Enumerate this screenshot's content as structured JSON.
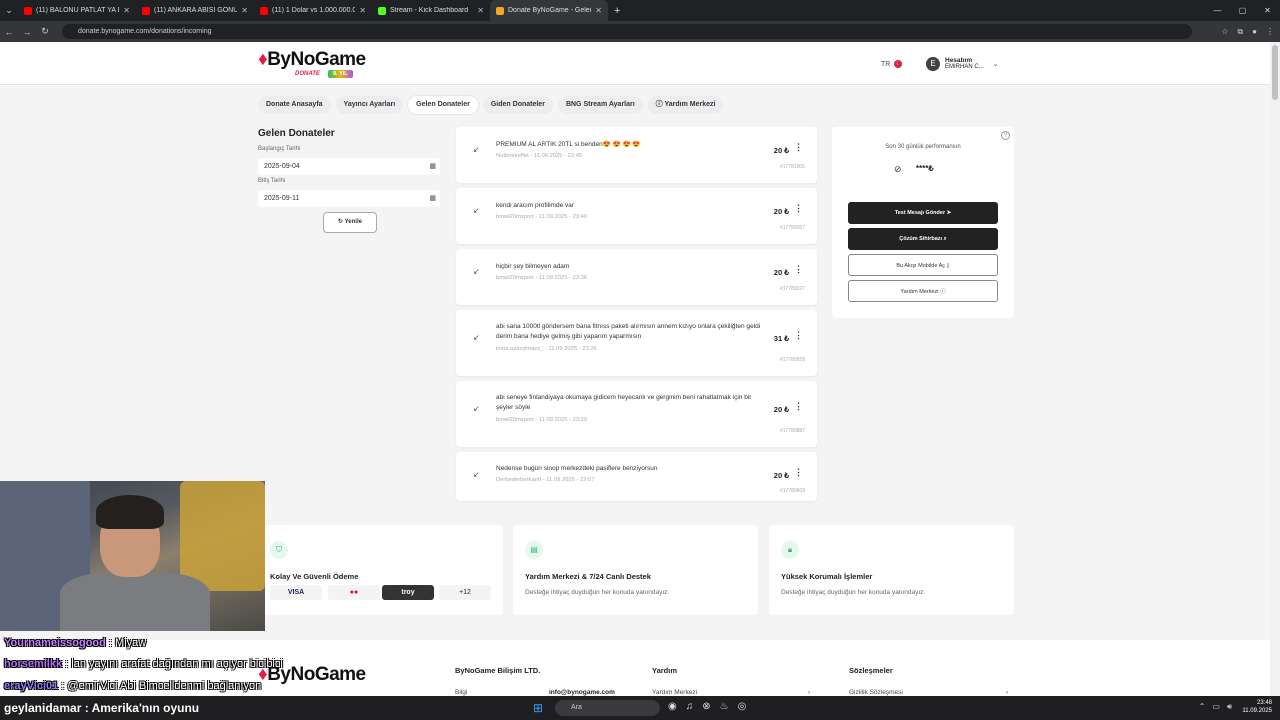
{
  "browser": {
    "tabs": [
      {
        "title": "(11) BALONU PATLAT YA DA GE",
        "color": "#ff0000"
      },
      {
        "title": "(11) ANKARA ABİSİ GÖNÜL Z",
        "color": "#ff0000"
      },
      {
        "title": "(11) 1 Dolar vs 1.000.000.000 D",
        "color": "#ff0000"
      },
      {
        "title": "Stream - Kick Dashboard",
        "color": "#53fc18"
      },
      {
        "title": "Donate ByNoGame - Gelen/Gid",
        "color": "#f5a623"
      }
    ],
    "new_tab": "+",
    "url": "donate.bynogame.com/donations/incoming"
  },
  "header": {
    "logo": "ByNoGame",
    "logo_sub": "DONATE",
    "badge": "9. YIL",
    "lang": "TR",
    "account_title": "Hesabım",
    "account_name": "EMIRHAN C...",
    "avatar_letter": "E"
  },
  "nav": [
    "Donate Anasayfa",
    "Yayıncı Ayarları",
    "Gelen Donateler",
    "Giden Donateler",
    "BNG Stream Ayarları",
    "Yardım Merkezi"
  ],
  "filters": {
    "title": "Gelen Donateler",
    "start_label": "Başlangıç Tarihi",
    "start_value": "2025-09-04",
    "end_label": "Bitiş Tarihi",
    "end_value": "2025-09-11",
    "refresh": "Yenile"
  },
  "donations": [
    {
      "message": "PREMIUM AL ARTIK 20TL si benden😍 😍 😍 😍",
      "meta": "Nutlerekeffet - 11.09.2025 - 23:45",
      "amount": "20 ₺",
      "id": "#17781505"
    },
    {
      "message": "kendi aracım profilimde var",
      "meta": "bmwl20msport - 11.09.2025 - 23:40",
      "amount": "20 ₺",
      "id": "#17783057"
    },
    {
      "message": "hiçbir şey bilmeyen adam",
      "meta": "bmwl20msport - 11.09.2025 - 23:36",
      "amount": "20 ₺",
      "id": "#17783027"
    },
    {
      "message": "abi sana 1000tl göndersem bana fitnıss paketi alırmısın annem kızıyo onlara çekiliğten geldi derim bana hediye gelmiş gibi yaparım yaparmısın",
      "meta": "insta.ayazylmazz_ - 11.09.2025 - 23:26",
      "amount": "31 ₺",
      "id": "#17780928"
    },
    {
      "message": "abi seneye finlandiyaya okumaya gidicem heyecanlı ve gerginim beni rahatlatmak için bir şeyler söyle",
      "meta": "bmwl20msport - 11.09.2025 - 23:19",
      "amount": "20 ₺",
      "id": "#17780887"
    },
    {
      "message": "Nedense bugün sinop merkezdeki pasiflere benziyorsun",
      "meta": "Derbederberkantt - 11.09.2025 - 22:57",
      "amount": "20 ₺",
      "id": "#17780609"
    }
  ],
  "performance": {
    "title": "Son 30 günlük performansın",
    "hidden_value": "****₺",
    "buttons": [
      "Test Mesajı Gönder",
      "Çözüm Sihirbazı",
      "Bu Akışı Mobilde Aç",
      "Yardım Merkezi"
    ]
  },
  "features": [
    {
      "title": "Kolay Ve Güvenli Ödeme",
      "desc": ""
    },
    {
      "title": "Yardım Merkezi & 7/24 Canlı Destek",
      "desc": "Desteğe ihtiyaç duyduğun her konuda yanındayız."
    },
    {
      "title": "Yüksek Korumalı İşlemler",
      "desc": "Desteğe ihtiyaç duyduğun her konuda yanındayız."
    }
  ],
  "payments": [
    "VISA",
    "●●",
    "troy",
    "+12"
  ],
  "footer": {
    "logo": "ByNoGame",
    "company": "ByNoGame Bilişim LTD.",
    "info_label": "Bilgi",
    "email": "info@bynogame.com",
    "help_heading": "Yardım",
    "help_link": "Yardım Merkezi",
    "contracts_heading": "Sözleşmeler",
    "privacy_link": "Gizlilik Sözleşmesi"
  },
  "chat": [
    {
      "user": "Yournameissogood",
      "text": " : Miyaw"
    },
    {
      "user": "horsemilkk",
      "text": " : lan yayını arafat dağından mı açıyor bicibici"
    },
    {
      "user": "erayVici01",
      "text": " : @emirVici Abi Bimcelldenmi bağlanıyon"
    }
  ],
  "bottom_chat": {
    "user": "geylanidamar",
    "text": " : Amerika'nın oyunu"
  },
  "taskbar": {
    "search": "Ara",
    "time": "23:48",
    "date": "11.09.2025"
  }
}
